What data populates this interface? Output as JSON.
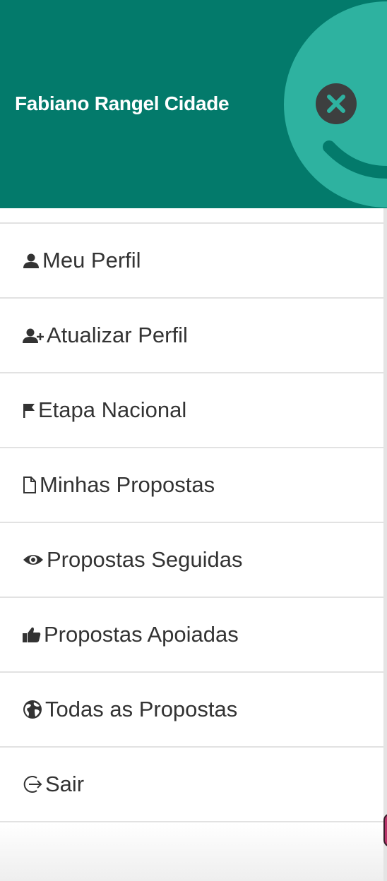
{
  "header": {
    "user_name": "Fabiano Rangel Cidade",
    "close_icon": "close-icon",
    "colors": {
      "background": "#037a6b",
      "smile": "#2eb2a0",
      "close_button": "#3d3f3f"
    }
  },
  "menu": {
    "items": [
      {
        "label": "Meu Perfil",
        "icon": "user-icon"
      },
      {
        "label": "Atualizar Perfil",
        "icon": "user-plus-icon"
      },
      {
        "label": "Etapa Nacional",
        "icon": "flag-icon"
      },
      {
        "label": "Minhas Propostas",
        "icon": "file-icon"
      },
      {
        "label": "Propostas Seguidas",
        "icon": "eye-icon"
      },
      {
        "label": "Propostas Apoiadas",
        "icon": "thumbs-up-icon"
      },
      {
        "label": "Todas as Propostas",
        "icon": "globe-icon"
      },
      {
        "label": "Sair",
        "icon": "logout-icon"
      }
    ]
  }
}
